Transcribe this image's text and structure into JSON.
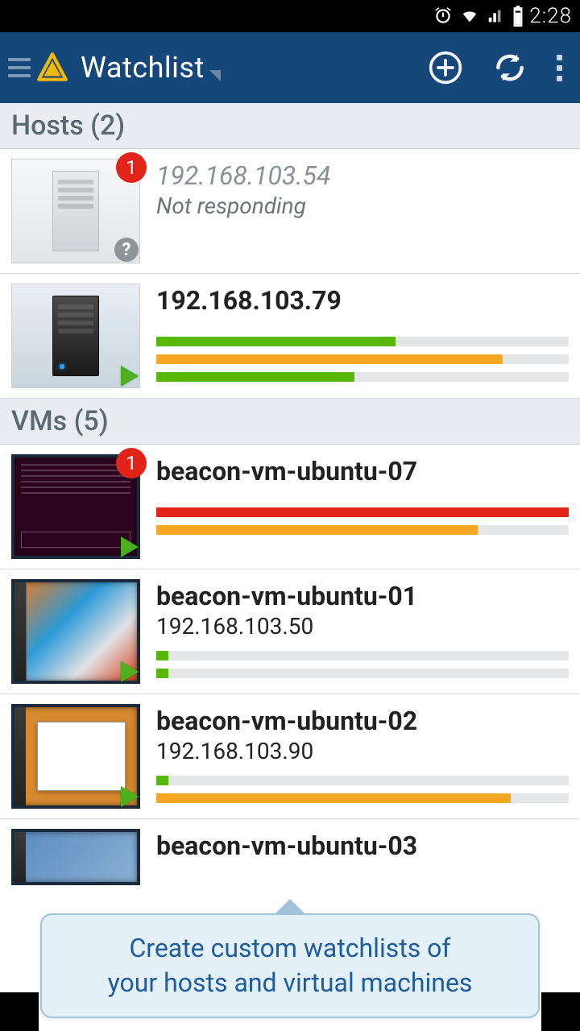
{
  "status_bar": {
    "time": "2:28"
  },
  "app_bar": {
    "title": "Watchlist"
  },
  "sections": {
    "hosts": {
      "header": "Hosts (2)",
      "items": [
        {
          "title": "192.168.103.54",
          "subtitle": "Not responding",
          "badge": "1"
        },
        {
          "title": "192.168.103.79"
        }
      ]
    },
    "vms": {
      "header": "VMs (5)",
      "items": [
        {
          "title": "beacon-vm-ubuntu-07",
          "badge": "1"
        },
        {
          "title": "beacon-vm-ubuntu-01",
          "subtitle": "192.168.103.50"
        },
        {
          "title": "beacon-vm-ubuntu-02",
          "subtitle": "192.168.103.90"
        },
        {
          "title": "beacon-vm-ubuntu-03"
        }
      ]
    }
  },
  "bars": {
    "host2": [
      {
        "color": "green",
        "pct": 58
      },
      {
        "color": "orange",
        "pct": 84
      },
      {
        "color": "green",
        "pct": 48
      }
    ],
    "vm1": [
      {
        "color": "red",
        "pct": 100
      },
      {
        "color": "orange",
        "pct": 78
      }
    ],
    "vm2": [
      {
        "color": "green",
        "pct": 3
      },
      {
        "color": "green",
        "pct": 3
      }
    ],
    "vm3": [
      {
        "color": "green",
        "pct": 3
      },
      {
        "color": "orange",
        "pct": 86
      }
    ]
  },
  "callout": {
    "line1": "Create custom watchlists of",
    "line2": "your hosts and virtual machines"
  }
}
